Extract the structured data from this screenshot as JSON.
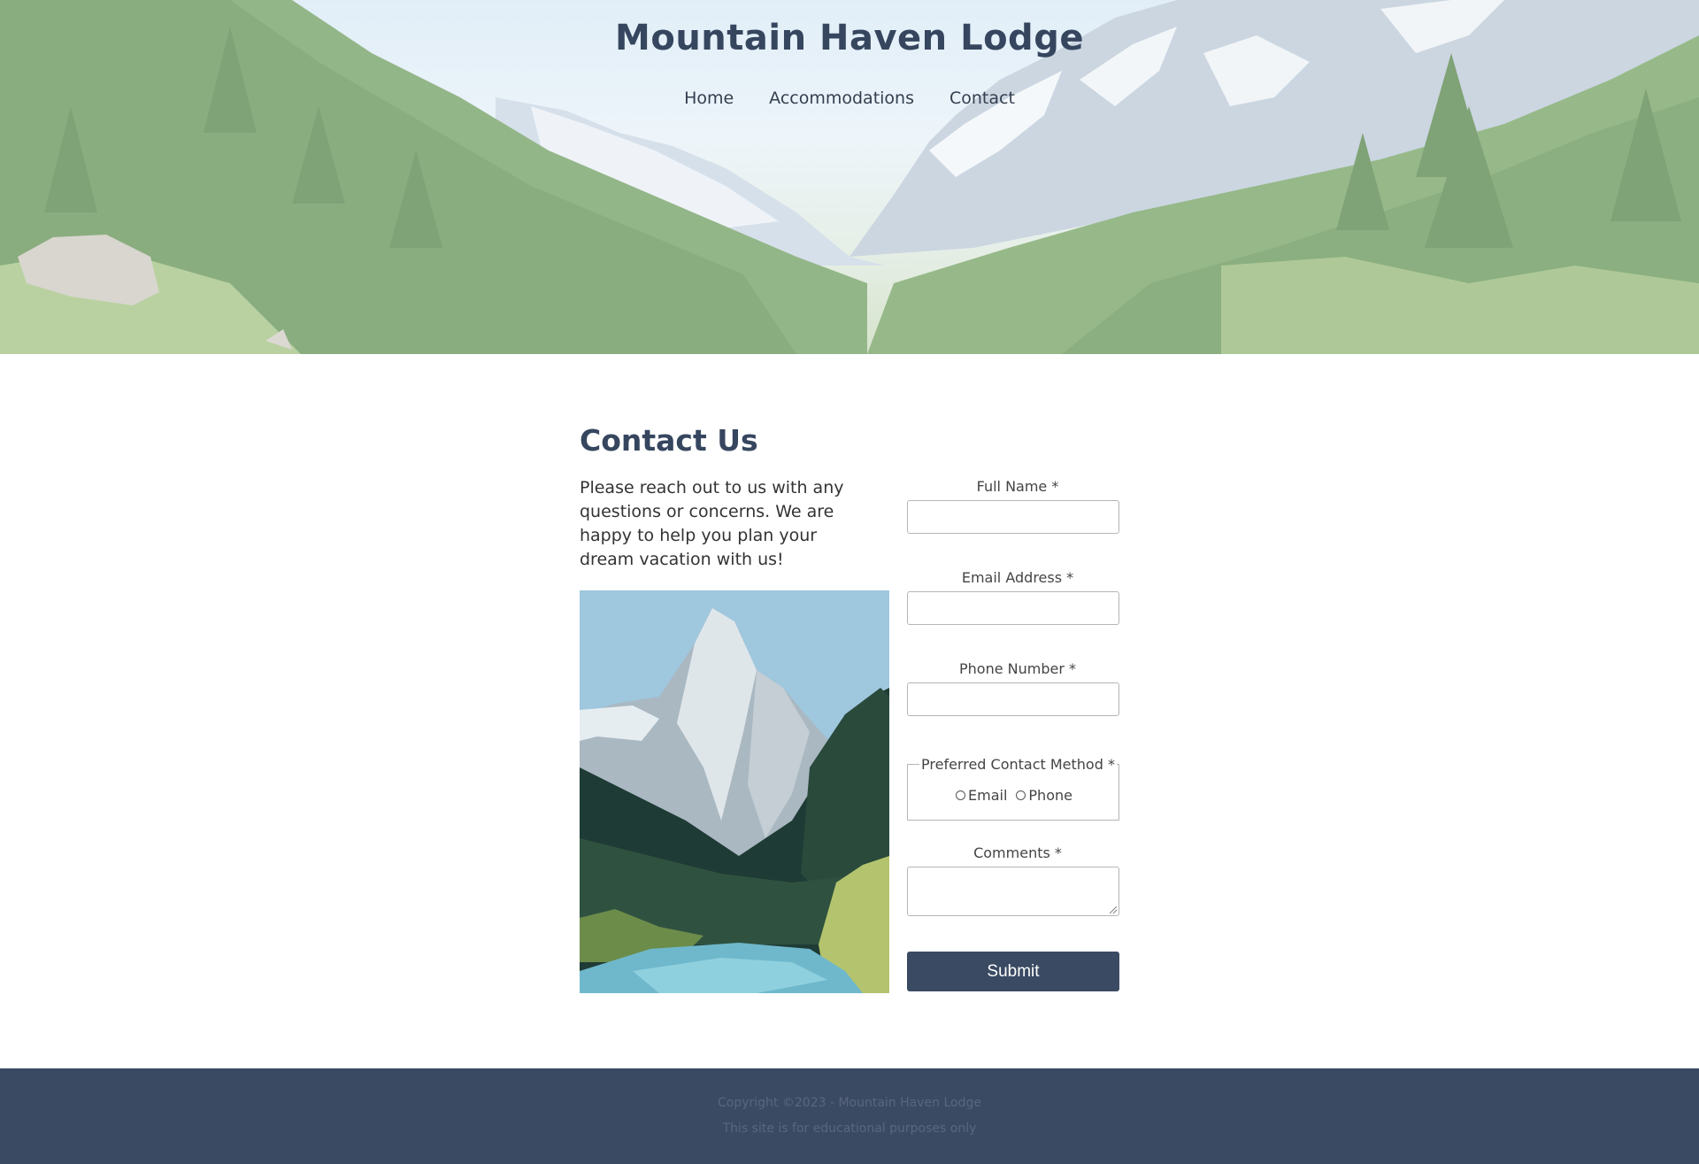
{
  "site": {
    "title": "Mountain Haven Lodge",
    "nav": [
      "Home",
      "Accommodations",
      "Contact"
    ]
  },
  "contact": {
    "heading": "Contact Us",
    "intro": "Please reach out to us with any questions or concerns. We are happy to help you plan your dream vacation with us!"
  },
  "form": {
    "full_name_label": "Full Name *",
    "full_name_value": "",
    "email_label": "Email Address *",
    "email_value": "",
    "phone_label": "Phone Number *",
    "phone_value": "",
    "contact_method_label": "Preferred Contact Method *",
    "contact_method_options": [
      "Email",
      "Phone"
    ],
    "comments_label": "Comments *",
    "comments_value": "",
    "submit_label": "Submit"
  },
  "footer": {
    "copyright": "Copyright ©2023 - Mountain Haven Lodge",
    "note": "This site is for educational purposes only"
  },
  "colors": {
    "primary": "#3a4a63",
    "heading": "#36465f",
    "footer_text": "#59677d"
  }
}
